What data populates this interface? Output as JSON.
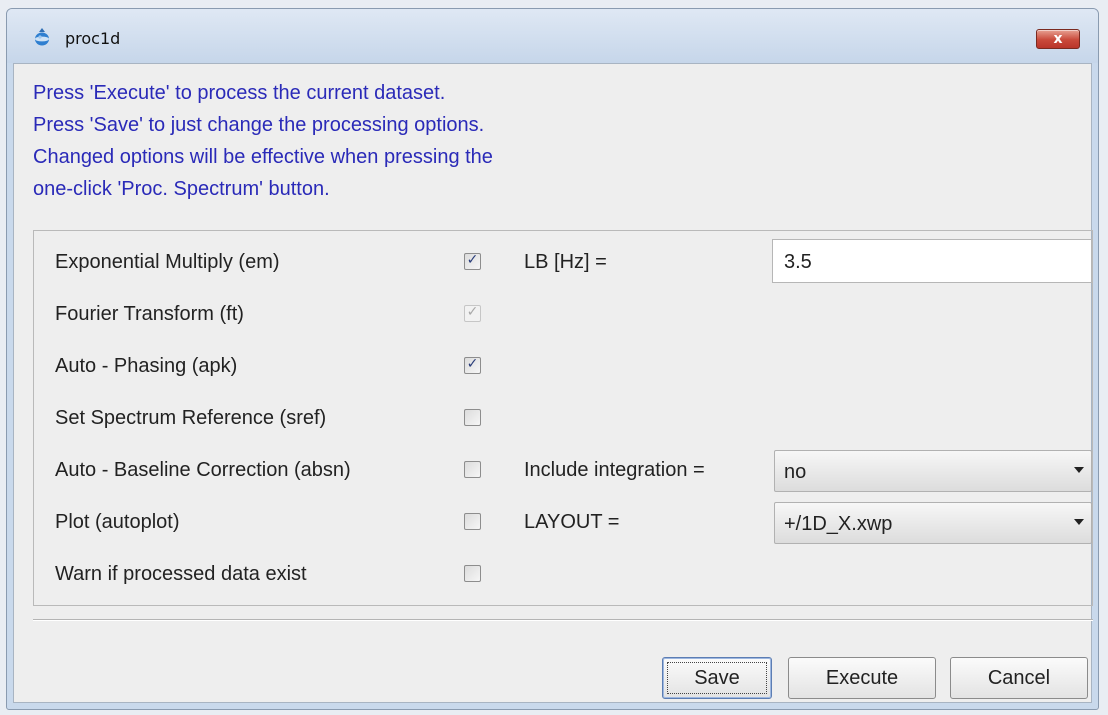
{
  "window": {
    "title": "proc1d",
    "close_label": "x"
  },
  "instructions": [
    "Press 'Execute' to process the current dataset.",
    "Press 'Save' to just change the processing options.",
    "Changed options will be effective when pressing the",
    "one-click 'Proc. Spectrum' button."
  ],
  "options": [
    {
      "label": "Exponential Multiply (em)",
      "checked": true,
      "enabled": true,
      "param": {
        "label": "LB [Hz] =",
        "type": "text",
        "value": "3.5"
      }
    },
    {
      "label": "Fourier Transform (ft)",
      "checked": true,
      "enabled": false
    },
    {
      "label": "Auto - Phasing (apk)",
      "checked": true,
      "enabled": true
    },
    {
      "label": "Set Spectrum Reference (sref)",
      "checked": false,
      "enabled": true
    },
    {
      "label": "Auto - Baseline Correction (absn)",
      "checked": false,
      "enabled": true,
      "param": {
        "label": "Include integration =",
        "type": "select",
        "value": "no"
      }
    },
    {
      "label": "Plot (autoplot)",
      "checked": false,
      "enabled": true,
      "param": {
        "label": "LAYOUT =",
        "type": "select",
        "value": "+/1D_X.xwp"
      }
    },
    {
      "label": "Warn if processed data exist",
      "checked": false,
      "enabled": true
    }
  ],
  "buttons": {
    "save": "Save",
    "execute": "Execute",
    "cancel": "Cancel"
  },
  "colors": {
    "instruction_text": "#2a2ab8",
    "close_button": "#c9493a"
  },
  "icons": {
    "app": "bruker-app-icon",
    "close": "close-icon",
    "dropdown": "chevron-down-icon"
  }
}
